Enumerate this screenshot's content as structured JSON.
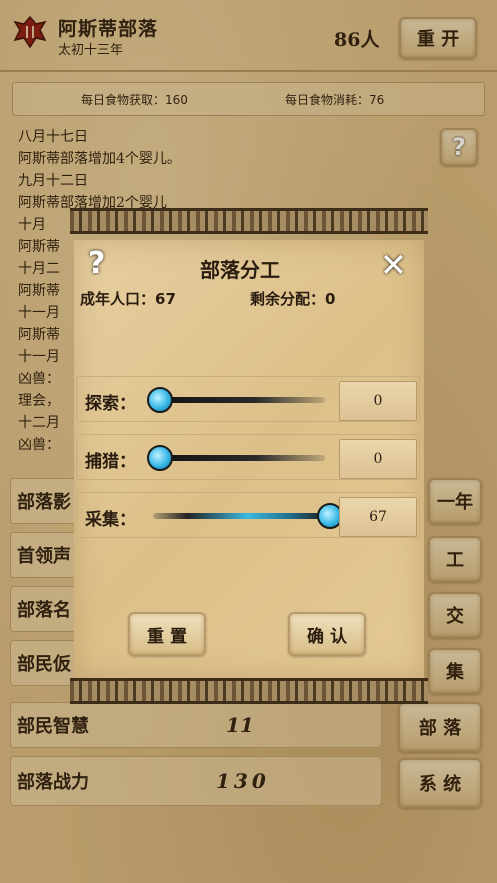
{
  "header": {
    "tribe_name": "阿斯蒂部落",
    "date": "太初十三年",
    "population": "86人",
    "restart_label": "重 开"
  },
  "food": {
    "gain_label": "每日食物获取：160",
    "consume_label": "每日食物消耗：76"
  },
  "log": [
    "八月十七日",
    "阿斯蒂部落增加4个婴儿。",
    "九月十二日",
    "阿斯蒂部落增加2个婴儿",
    "十月",
    "阿斯蒂",
    "十月二",
    "阿斯蒂",
    "十一月",
    "阿斯蒂",
    "十一月",
    "凶兽：",
    "理会，",
    "十二月",
    "凶兽："
  ],
  "help_icon_char": "?",
  "stats": [
    {
      "label": "部落影",
      "value": ""
    },
    {
      "label": "首领声",
      "value": ""
    },
    {
      "label": "部落名",
      "value": ""
    },
    {
      "label": "部民仮",
      "value": ""
    },
    {
      "label": "部民智慧",
      "value": "11"
    },
    {
      "label": "部落战力",
      "value": "130"
    }
  ],
  "side_buttons": [
    "一年",
    "工",
    "交",
    "集",
    "部 落",
    "系 统"
  ],
  "dialog": {
    "help_char": "?",
    "title": "部落分工",
    "close_char": "✕",
    "adult_population": "成年人口：67",
    "remaining": "剩余分配：0",
    "sliders": [
      {
        "label": "探索：",
        "value": "0",
        "fraction": 0
      },
      {
        "label": "捕猎：",
        "value": "0",
        "fraction": 0
      },
      {
        "label": "采集：",
        "value": "67",
        "fraction": 1
      }
    ],
    "reset_label": "重 置",
    "confirm_label": "确 认"
  },
  "colors": {
    "parchment": "#dcc089",
    "knob": "#37b8e6",
    "emblem": "#8b1a12"
  }
}
